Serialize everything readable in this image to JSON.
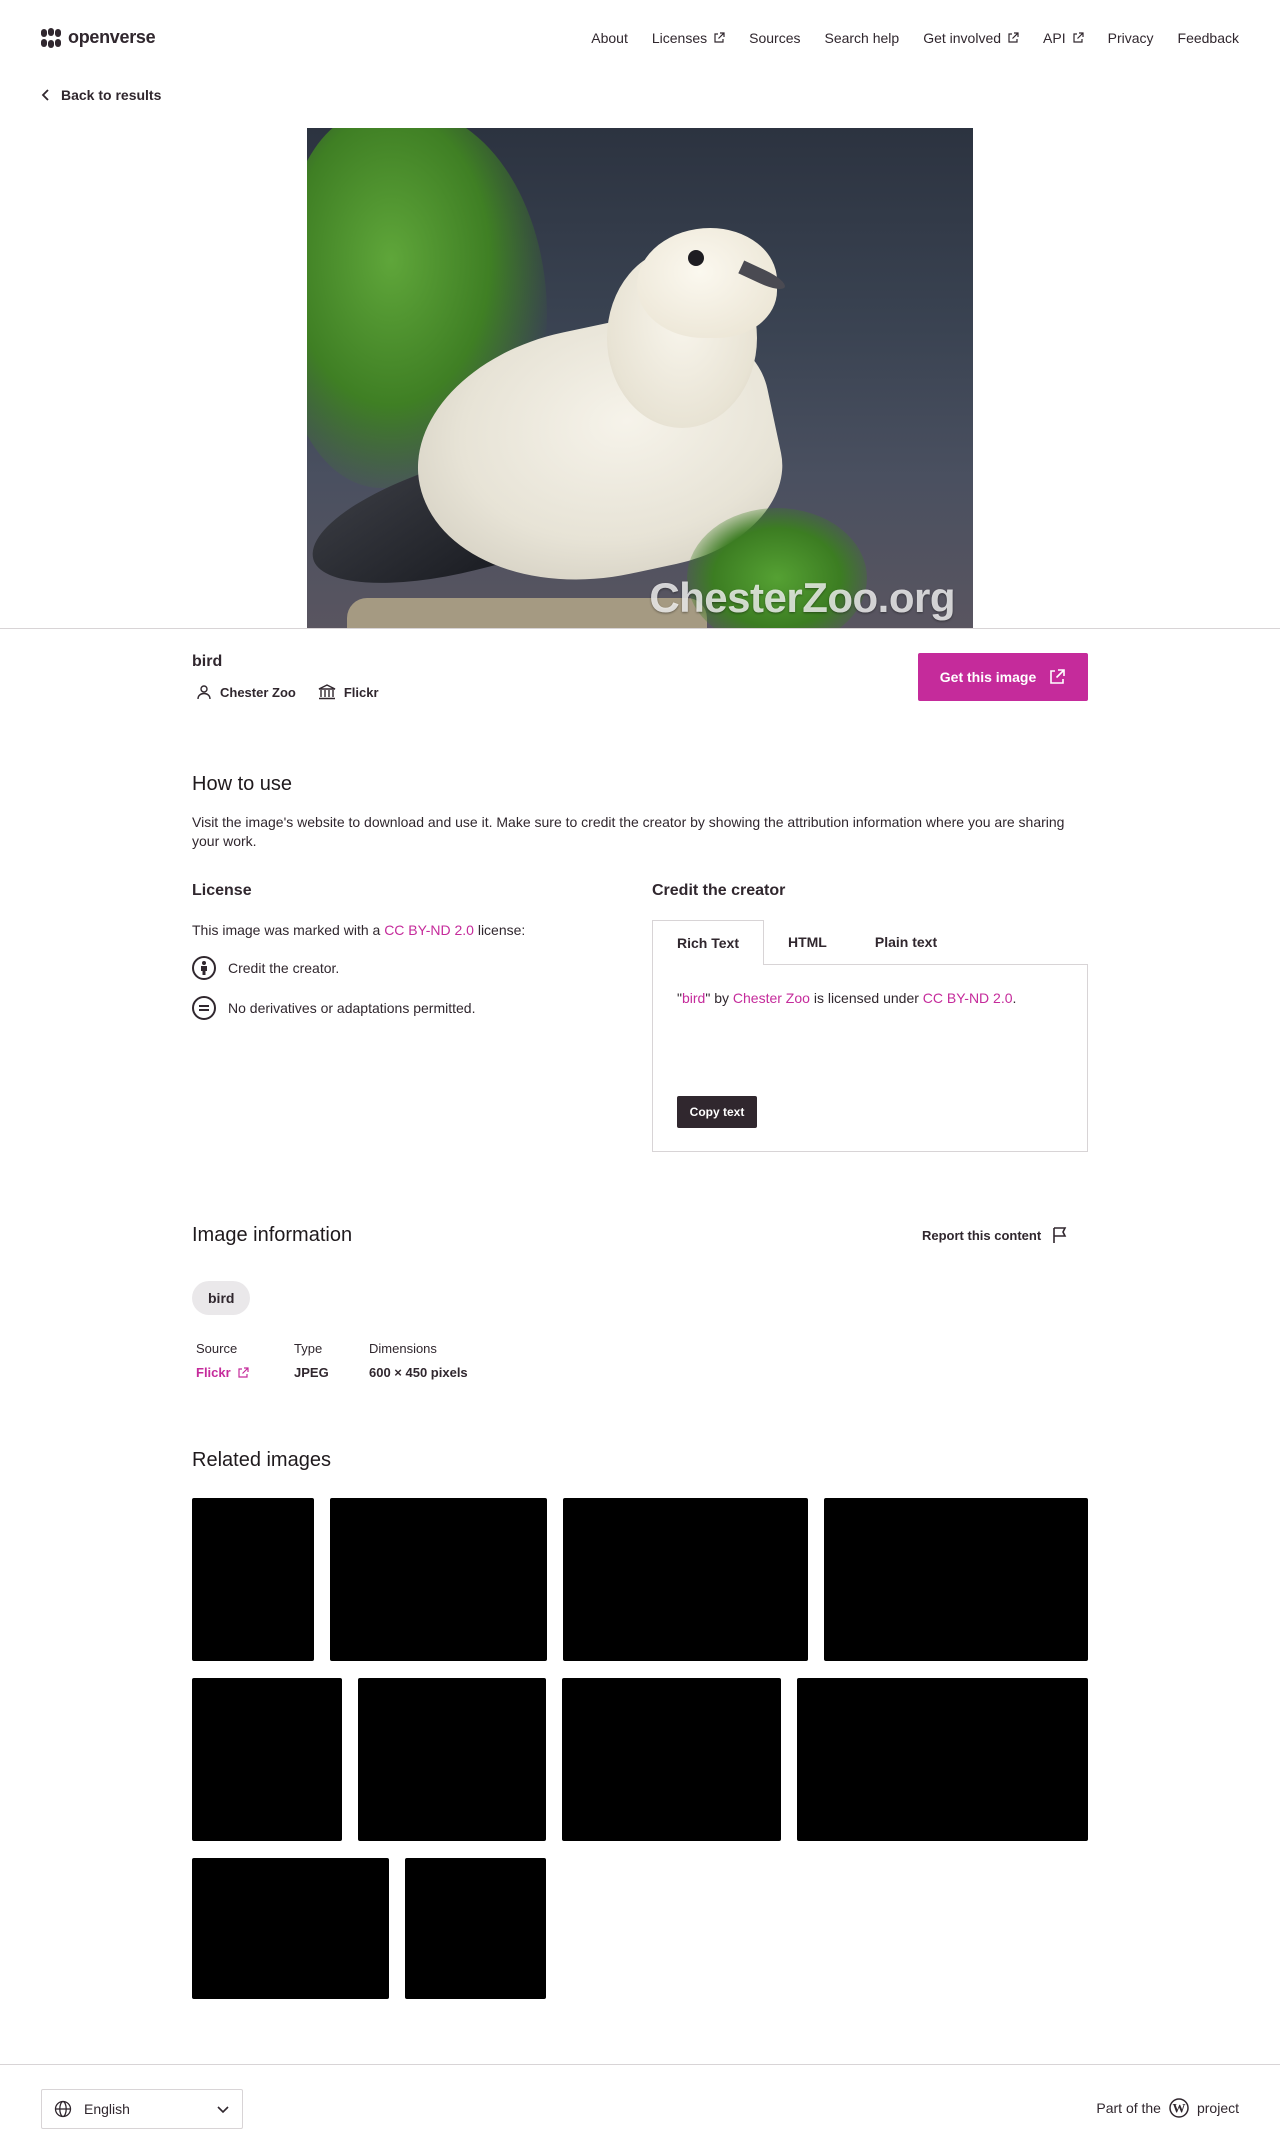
{
  "header": {
    "logo_text": "openverse",
    "nav": [
      {
        "label": "About",
        "external": false
      },
      {
        "label": "Licenses",
        "external": true
      },
      {
        "label": "Sources",
        "external": false
      },
      {
        "label": "Search help",
        "external": false
      },
      {
        "label": "Get involved",
        "external": true
      },
      {
        "label": "API",
        "external": true
      },
      {
        "label": "Privacy",
        "external": false
      },
      {
        "label": "Feedback",
        "external": false
      }
    ]
  },
  "back_label": "Back to results",
  "photo": {
    "watermark": "ChesterZoo.org"
  },
  "image": {
    "title": "bird",
    "creator": "Chester Zoo",
    "source": "Flickr",
    "get_button": "Get this image"
  },
  "how_to_use": {
    "heading": "How to use",
    "text": "Visit the image's website to download and use it. Make sure to credit the creator by showing the attribution information where you are sharing your work."
  },
  "license": {
    "heading": "License",
    "intro_pre": "This image was marked with a ",
    "intro_link": "CC BY-ND 2.0",
    "intro_post": " license:",
    "features": [
      {
        "icon": "by-icon",
        "text": "Credit the creator."
      },
      {
        "icon": "nd-icon",
        "text": "No derivatives or adaptations permitted."
      }
    ]
  },
  "credit": {
    "heading": "Credit the creator",
    "tabs": [
      "Rich Text",
      "HTML",
      "Plain text"
    ],
    "active_tab": "Rich Text",
    "q_open": "\"",
    "title_link": "bird",
    "q_close": "\" by ",
    "creator_link": "Chester Zoo",
    "mid": " is licensed under ",
    "license_link": "CC BY-ND 2.0",
    "end": ".",
    "copy_button": "Copy text"
  },
  "info": {
    "heading": "Image information",
    "report": "Report this content",
    "tag": "bird",
    "source_label": "Source",
    "source_value": "Flickr",
    "type_label": "Type",
    "type_value": "JPEG",
    "dimensions_label": "Dimensions",
    "dimensions_value": "600 × 450 pixels"
  },
  "related": {
    "heading": "Related images"
  },
  "footer": {
    "language": "English",
    "part_pre": "Part of the",
    "part_post": "project"
  },
  "colors": {
    "accent": "#c52b9b",
    "text": "#30272e",
    "border": "#d8d4d6"
  }
}
